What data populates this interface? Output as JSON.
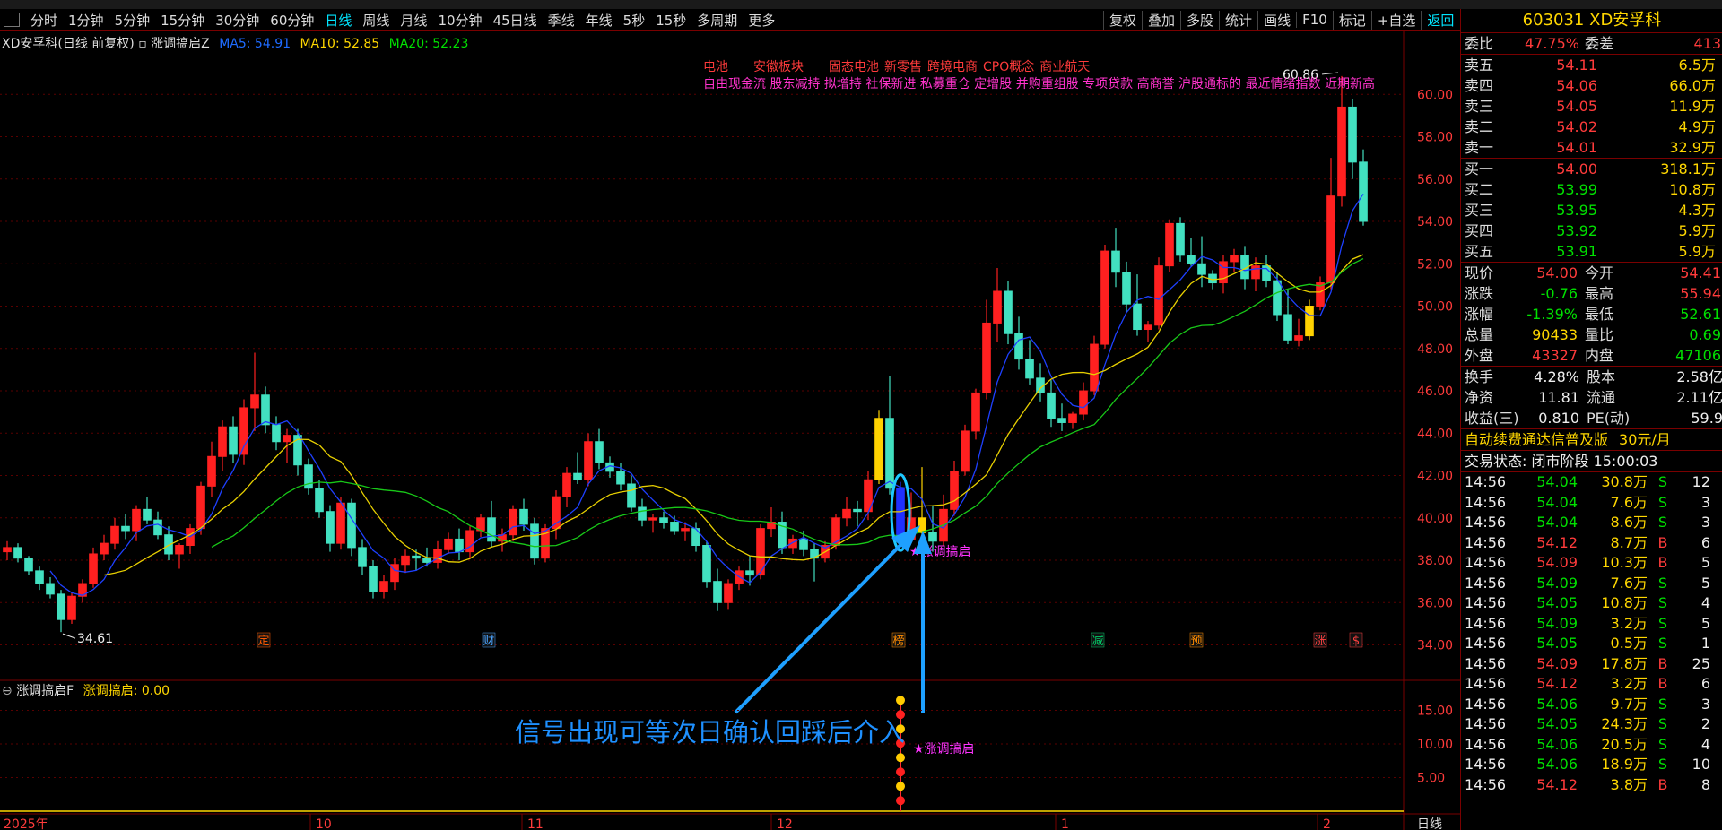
{
  "periods": [
    "分时",
    "1分钟",
    "5分钟",
    "15分钟",
    "30分钟",
    "60分钟",
    "日线",
    "周线",
    "月线",
    "10分钟",
    "45日线",
    "季线",
    "年线",
    "5秒",
    "15秒",
    "多周期",
    "更多"
  ],
  "active_period": "日线",
  "toolbar_right": [
    "复权",
    "叠加",
    "多股",
    "统计",
    "画线",
    "F10",
    "标记",
    "+自选",
    "返回"
  ],
  "active_tool": "返回",
  "legend": {
    "title": "XD安孚科(日线 前复权)",
    "indicator": "涨调搞启Z",
    "ma5_label": "MA5: 54.91",
    "ma10_label": "MA10: 52.85",
    "ma20_label": "MA20: 52.23"
  },
  "concepts_row1": [
    "电池",
    "安徽板块",
    "固态电池",
    "新零售",
    "跨境电商",
    "CPO概念",
    "商业航天"
  ],
  "concepts_row2": "自由现金流 股东减持 拟增持 社保新进 私募重仓 定增股 并购重组股 专项贷款 高商誉 沪股通标的 最近情绪指数 近期新高",
  "price_axis": [
    "60.00",
    "58.00",
    "56.00",
    "54.00",
    "52.00",
    "50.00",
    "48.00",
    "46.00",
    "44.00",
    "42.00",
    "40.00",
    "38.00",
    "36.00",
    "34.00"
  ],
  "high_label": "60.86",
  "low_label": "34.61",
  "signal_label": "涨调搞启",
  "signal_label_sub": "涨调搞启",
  "event_markers": [
    {
      "text": "定",
      "color": "#ff5a00"
    },
    {
      "text": "财",
      "color": "#4aa3ff"
    },
    {
      "text": "榜",
      "color": "#ff8c00"
    },
    {
      "text": "减",
      "color": "#00cc66"
    },
    {
      "text": "预",
      "color": "#ff8c00"
    },
    {
      "text": "涨",
      "color": "#ff4040"
    },
    {
      "text": "$",
      "color": "#ff4040"
    }
  ],
  "annotation": "信号出现可等次日确认回踩后介入",
  "sub_legend": {
    "name": "涨调搞启F",
    "value": "涨调搞启: 0.00"
  },
  "sub_axis": [
    "15.00",
    "10.00",
    "5.00"
  ],
  "date_axis": [
    "2025年",
    "10",
    "11",
    "12",
    "1",
    "2"
  ],
  "date_axis_unit": "日线",
  "chart_data": {
    "type": "candlestick",
    "ylim": [
      32.5,
      62.0
    ],
    "candles": [
      [
        38.4,
        38.9,
        38.0,
        38.6
      ],
      [
        38.6,
        38.8,
        37.9,
        38.1
      ],
      [
        38.1,
        38.2,
        37.3,
        37.5
      ],
      [
        37.5,
        37.7,
        36.6,
        36.9
      ],
      [
        36.9,
        37.2,
        36.2,
        36.4
      ],
      [
        36.4,
        36.6,
        34.61,
        35.2
      ],
      [
        35.2,
        36.5,
        35.0,
        36.3
      ],
      [
        36.3,
        37.1,
        36.0,
        36.9
      ],
      [
        36.9,
        38.6,
        36.7,
        38.3
      ],
      [
        38.3,
        39.2,
        38.0,
        38.8
      ],
      [
        38.8,
        40.0,
        38.5,
        39.6
      ],
      [
        39.6,
        40.2,
        39.0,
        39.4
      ],
      [
        39.4,
        40.6,
        38.9,
        40.4
      ],
      [
        40.4,
        41.0,
        39.7,
        39.9
      ],
      [
        39.9,
        40.3,
        39.0,
        39.2
      ],
      [
        39.2,
        39.6,
        38.0,
        38.3
      ],
      [
        38.3,
        38.8,
        37.6,
        38.7
      ],
      [
        38.7,
        39.7,
        38.3,
        39.5
      ],
      [
        39.5,
        41.7,
        39.2,
        41.5
      ],
      [
        41.5,
        43.6,
        41.0,
        42.9
      ],
      [
        42.9,
        44.6,
        42.2,
        44.3
      ],
      [
        44.3,
        44.8,
        42.6,
        43.0
      ],
      [
        43.0,
        45.6,
        42.5,
        45.2
      ],
      [
        45.2,
        47.8,
        44.1,
        45.8
      ],
      [
        45.8,
        46.2,
        44.0,
        44.4
      ],
      [
        44.4,
        44.8,
        43.2,
        43.6
      ],
      [
        43.6,
        44.2,
        42.6,
        43.9
      ],
      [
        43.9,
        44.2,
        42.0,
        42.5
      ],
      [
        42.5,
        42.8,
        41.1,
        41.4
      ],
      [
        41.4,
        41.8,
        40.0,
        40.3
      ],
      [
        40.3,
        40.6,
        38.4,
        38.8
      ],
      [
        38.8,
        41.0,
        38.5,
        40.7
      ],
      [
        40.7,
        40.9,
        38.2,
        38.6
      ],
      [
        38.6,
        39.0,
        37.3,
        37.7
      ],
      [
        37.7,
        38.0,
        36.2,
        36.5
      ],
      [
        36.5,
        37.3,
        36.2,
        37.0
      ],
      [
        37.0,
        38.1,
        36.6,
        37.8
      ],
      [
        37.8,
        38.5,
        37.4,
        38.2
      ],
      [
        38.2,
        38.5,
        37.5,
        38.1
      ],
      [
        38.1,
        38.6,
        37.7,
        37.9
      ],
      [
        37.9,
        38.9,
        37.6,
        38.5
      ],
      [
        38.5,
        39.3,
        38.3,
        39.0
      ],
      [
        39.0,
        39.5,
        38.0,
        38.4
      ],
      [
        38.4,
        39.6,
        38.1,
        39.4
      ],
      [
        39.4,
        40.2,
        39.1,
        40.0
      ],
      [
        40.0,
        40.8,
        38.6,
        38.9
      ],
      [
        38.9,
        39.5,
        38.4,
        39.2
      ],
      [
        39.2,
        40.6,
        38.9,
        40.4
      ],
      [
        40.4,
        40.9,
        39.4,
        39.7
      ],
      [
        39.7,
        40.0,
        37.8,
        38.1
      ],
      [
        38.1,
        39.7,
        37.9,
        39.5
      ],
      [
        39.5,
        41.3,
        39.0,
        41.0
      ],
      [
        41.0,
        42.4,
        40.5,
        42.1
      ],
      [
        42.1,
        43.1,
        41.6,
        41.8
      ],
      [
        41.8,
        44.0,
        41.5,
        43.6
      ],
      [
        43.6,
        44.2,
        42.3,
        42.6
      ],
      [
        42.6,
        42.9,
        41.9,
        42.2
      ],
      [
        42.2,
        42.6,
        41.3,
        41.6
      ],
      [
        41.6,
        42.0,
        40.3,
        40.5
      ],
      [
        40.5,
        40.9,
        39.6,
        39.9
      ],
      [
        39.9,
        40.2,
        39.3,
        40.0
      ],
      [
        40.0,
        40.3,
        39.5,
        39.8
      ],
      [
        39.8,
        40.1,
        39.2,
        39.4
      ],
      [
        39.4,
        39.8,
        38.9,
        39.5
      ],
      [
        39.5,
        39.8,
        38.4,
        38.7
      ],
      [
        38.7,
        38.9,
        36.7,
        37.0
      ],
      [
        37.0,
        37.6,
        35.6,
        36.0
      ],
      [
        36.0,
        37.1,
        35.7,
        36.9
      ],
      [
        36.9,
        37.7,
        36.6,
        37.5
      ],
      [
        37.5,
        38.2,
        36.8,
        37.3
      ],
      [
        37.3,
        39.7,
        37.1,
        39.5
      ],
      [
        39.5,
        40.5,
        39.1,
        39.8
      ],
      [
        39.8,
        40.3,
        38.3,
        38.6
      ],
      [
        38.6,
        39.2,
        38.3,
        39.0
      ],
      [
        39.0,
        39.4,
        38.2,
        38.5
      ],
      [
        38.5,
        38.8,
        37.0,
        38.1
      ],
      [
        38.1,
        38.9,
        37.9,
        38.7
      ],
      [
        38.7,
        40.2,
        38.5,
        40.0
      ],
      [
        40.0,
        41.0,
        39.6,
        40.4
      ],
      [
        40.4,
        40.8,
        39.6,
        40.3
      ],
      [
        40.3,
        42.2,
        39.9,
        41.8
      ],
      [
        41.8,
        45.1,
        41.6,
        44.7
      ],
      [
        44.7,
        46.7,
        41.1,
        41.4
      ],
      [
        41.4,
        41.7,
        38.8,
        39.0
      ],
      [
        39.0,
        41.2,
        38.9,
        40.0
      ],
      [
        40.0,
        42.4,
        38.9,
        39.3
      ],
      [
        39.3,
        40.6,
        38.4,
        38.9
      ],
      [
        38.9,
        41.1,
        38.7,
        40.4
      ],
      [
        40.4,
        42.7,
        40.1,
        42.2
      ],
      [
        42.2,
        44.4,
        42.0,
        44.1
      ],
      [
        44.1,
        46.1,
        43.7,
        45.9
      ],
      [
        45.9,
        50.3,
        45.6,
        49.2
      ],
      [
        49.2,
        51.8,
        48.3,
        50.7
      ],
      [
        50.7,
        51.2,
        48.2,
        48.7
      ],
      [
        48.7,
        49.5,
        47.0,
        47.5
      ],
      [
        47.5,
        48.4,
        46.3,
        46.6
      ],
      [
        46.6,
        47.3,
        45.5,
        45.9
      ],
      [
        45.9,
        46.5,
        44.3,
        44.7
      ],
      [
        44.7,
        45.4,
        44.1,
        44.5
      ],
      [
        44.5,
        45.0,
        44.2,
        44.9
      ],
      [
        44.9,
        46.4,
        44.6,
        46.0
      ],
      [
        46.0,
        48.6,
        45.8,
        48.2
      ],
      [
        48.2,
        52.9,
        48.0,
        52.6
      ],
      [
        52.6,
        53.7,
        50.9,
        51.6
      ],
      [
        51.6,
        52.1,
        49.7,
        50.1
      ],
      [
        50.1,
        51.5,
        48.6,
        48.9
      ],
      [
        48.9,
        49.3,
        48.3,
        49.1
      ],
      [
        49.1,
        52.3,
        48.9,
        51.9
      ],
      [
        51.9,
        54.1,
        51.6,
        53.9
      ],
      [
        53.9,
        54.2,
        52.1,
        52.4
      ],
      [
        52.4,
        53.2,
        51.9,
        52.0
      ],
      [
        52.0,
        53.3,
        50.9,
        51.5
      ],
      [
        51.5,
        51.7,
        50.8,
        51.1
      ],
      [
        51.1,
        52.4,
        50.6,
        52.1
      ],
      [
        52.1,
        52.7,
        51.6,
        52.4
      ],
      [
        52.4,
        52.8,
        50.8,
        51.3
      ],
      [
        51.3,
        52.3,
        50.7,
        51.9
      ],
      [
        51.9,
        52.4,
        50.9,
        51.2
      ],
      [
        51.2,
        51.6,
        49.3,
        49.6
      ],
      [
        49.6,
        50.8,
        48.2,
        48.4
      ],
      [
        48.4,
        49.4,
        48.1,
        48.6
      ],
      [
        48.6,
        50.3,
        48.4,
        50.0
      ],
      [
        50.0,
        51.4,
        49.8,
        51.1
      ],
      [
        51.1,
        57.0,
        50.8,
        55.2
      ],
      [
        55.2,
        60.86,
        54.7,
        59.4
      ],
      [
        59.4,
        59.8,
        56.0,
        56.8
      ],
      [
        56.8,
        57.4,
        53.8,
        54.0
      ]
    ],
    "signal_index": 83
  },
  "quote": {
    "code_name": "603031 XD安孚科",
    "wb_label": "委比",
    "wb_value": "47.75%",
    "wc_label": "委差",
    "wc_value": "413",
    "asks": [
      {
        "label": "卖五",
        "price": "54.11",
        "vol": "6.5万"
      },
      {
        "label": "卖四",
        "price": "54.06",
        "vol": "66.0万"
      },
      {
        "label": "卖三",
        "price": "54.05",
        "vol": "11.9万"
      },
      {
        "label": "卖二",
        "price": "54.02",
        "vol": "4.9万"
      },
      {
        "label": "卖一",
        "price": "54.01",
        "vol": "32.9万"
      }
    ],
    "bids": [
      {
        "label": "买一",
        "price": "54.00",
        "vol": "318.1万"
      },
      {
        "label": "买二",
        "price": "53.99",
        "vol": "10.8万"
      },
      {
        "label": "买三",
        "price": "53.95",
        "vol": "4.3万"
      },
      {
        "label": "买四",
        "price": "53.92",
        "vol": "5.9万"
      },
      {
        "label": "买五",
        "price": "53.91",
        "vol": "5.9万"
      }
    ],
    "stats": [
      {
        "l1": "现价",
        "v1": "54.00",
        "c1": "red",
        "l2": "今开",
        "v2": "54.41",
        "c2": "red"
      },
      {
        "l1": "涨跌",
        "v1": "-0.76",
        "c1": "green",
        "l2": "最高",
        "v2": "55.94",
        "c2": "red"
      },
      {
        "l1": "涨幅",
        "v1": "-1.39%",
        "c1": "green",
        "l2": "最低",
        "v2": "52.61",
        "c2": "green"
      },
      {
        "l1": "总量",
        "v1": "90433",
        "c1": "yellow",
        "l2": "量比",
        "v2": "0.69",
        "c2": "green"
      },
      {
        "l1": "外盘",
        "v1": "43327",
        "c1": "red",
        "l2": "内盘",
        "v2": "47106",
        "c2": "green"
      }
    ],
    "stats2": [
      {
        "l1": "换手",
        "v1": "4.28%",
        "l2": "股本",
        "v2": "2.58亿"
      },
      {
        "l1": "净资",
        "v1": "11.81",
        "l2": "流通",
        "v2": "2.11亿"
      },
      {
        "l1": "收益(三)",
        "v1": "0.810",
        "l2": "PE(动)",
        "v2": "59.9"
      }
    ],
    "ad_text": "自动续费通达信普及版",
    "ad_price": "30元/月",
    "trade_status": "交易状态: 闭市阶段 15:00:03",
    "ticks": [
      [
        "14:56",
        "54.04",
        "30.8万",
        "S",
        "12",
        "green"
      ],
      [
        "14:56",
        "54.04",
        "7.6万",
        "S",
        "3",
        "green"
      ],
      [
        "14:56",
        "54.04",
        "8.6万",
        "S",
        "3",
        "green"
      ],
      [
        "14:56",
        "54.12",
        "8.7万",
        "B",
        "6",
        "red"
      ],
      [
        "14:56",
        "54.09",
        "10.3万",
        "B",
        "5",
        "red"
      ],
      [
        "14:56",
        "54.09",
        "7.6万",
        "S",
        "5",
        "green"
      ],
      [
        "14:56",
        "54.05",
        "10.8万",
        "S",
        "4",
        "green"
      ],
      [
        "14:56",
        "54.09",
        "3.2万",
        "S",
        "5",
        "green"
      ],
      [
        "14:56",
        "54.05",
        "0.5万",
        "S",
        "1",
        "green"
      ],
      [
        "14:56",
        "54.09",
        "17.8万",
        "B",
        "25",
        "red"
      ],
      [
        "14:56",
        "54.12",
        "3.2万",
        "B",
        "6",
        "red"
      ],
      [
        "14:56",
        "54.06",
        "9.7万",
        "S",
        "3",
        "green"
      ],
      [
        "14:56",
        "54.05",
        "24.3万",
        "S",
        "2",
        "green"
      ],
      [
        "14:56",
        "54.06",
        "20.5万",
        "S",
        "4",
        "green"
      ],
      [
        "14:56",
        "54.06",
        "18.9万",
        "S",
        "10",
        "green"
      ],
      [
        "14:56",
        "54.12",
        "3.8万",
        "B",
        "8",
        "red"
      ]
    ]
  }
}
